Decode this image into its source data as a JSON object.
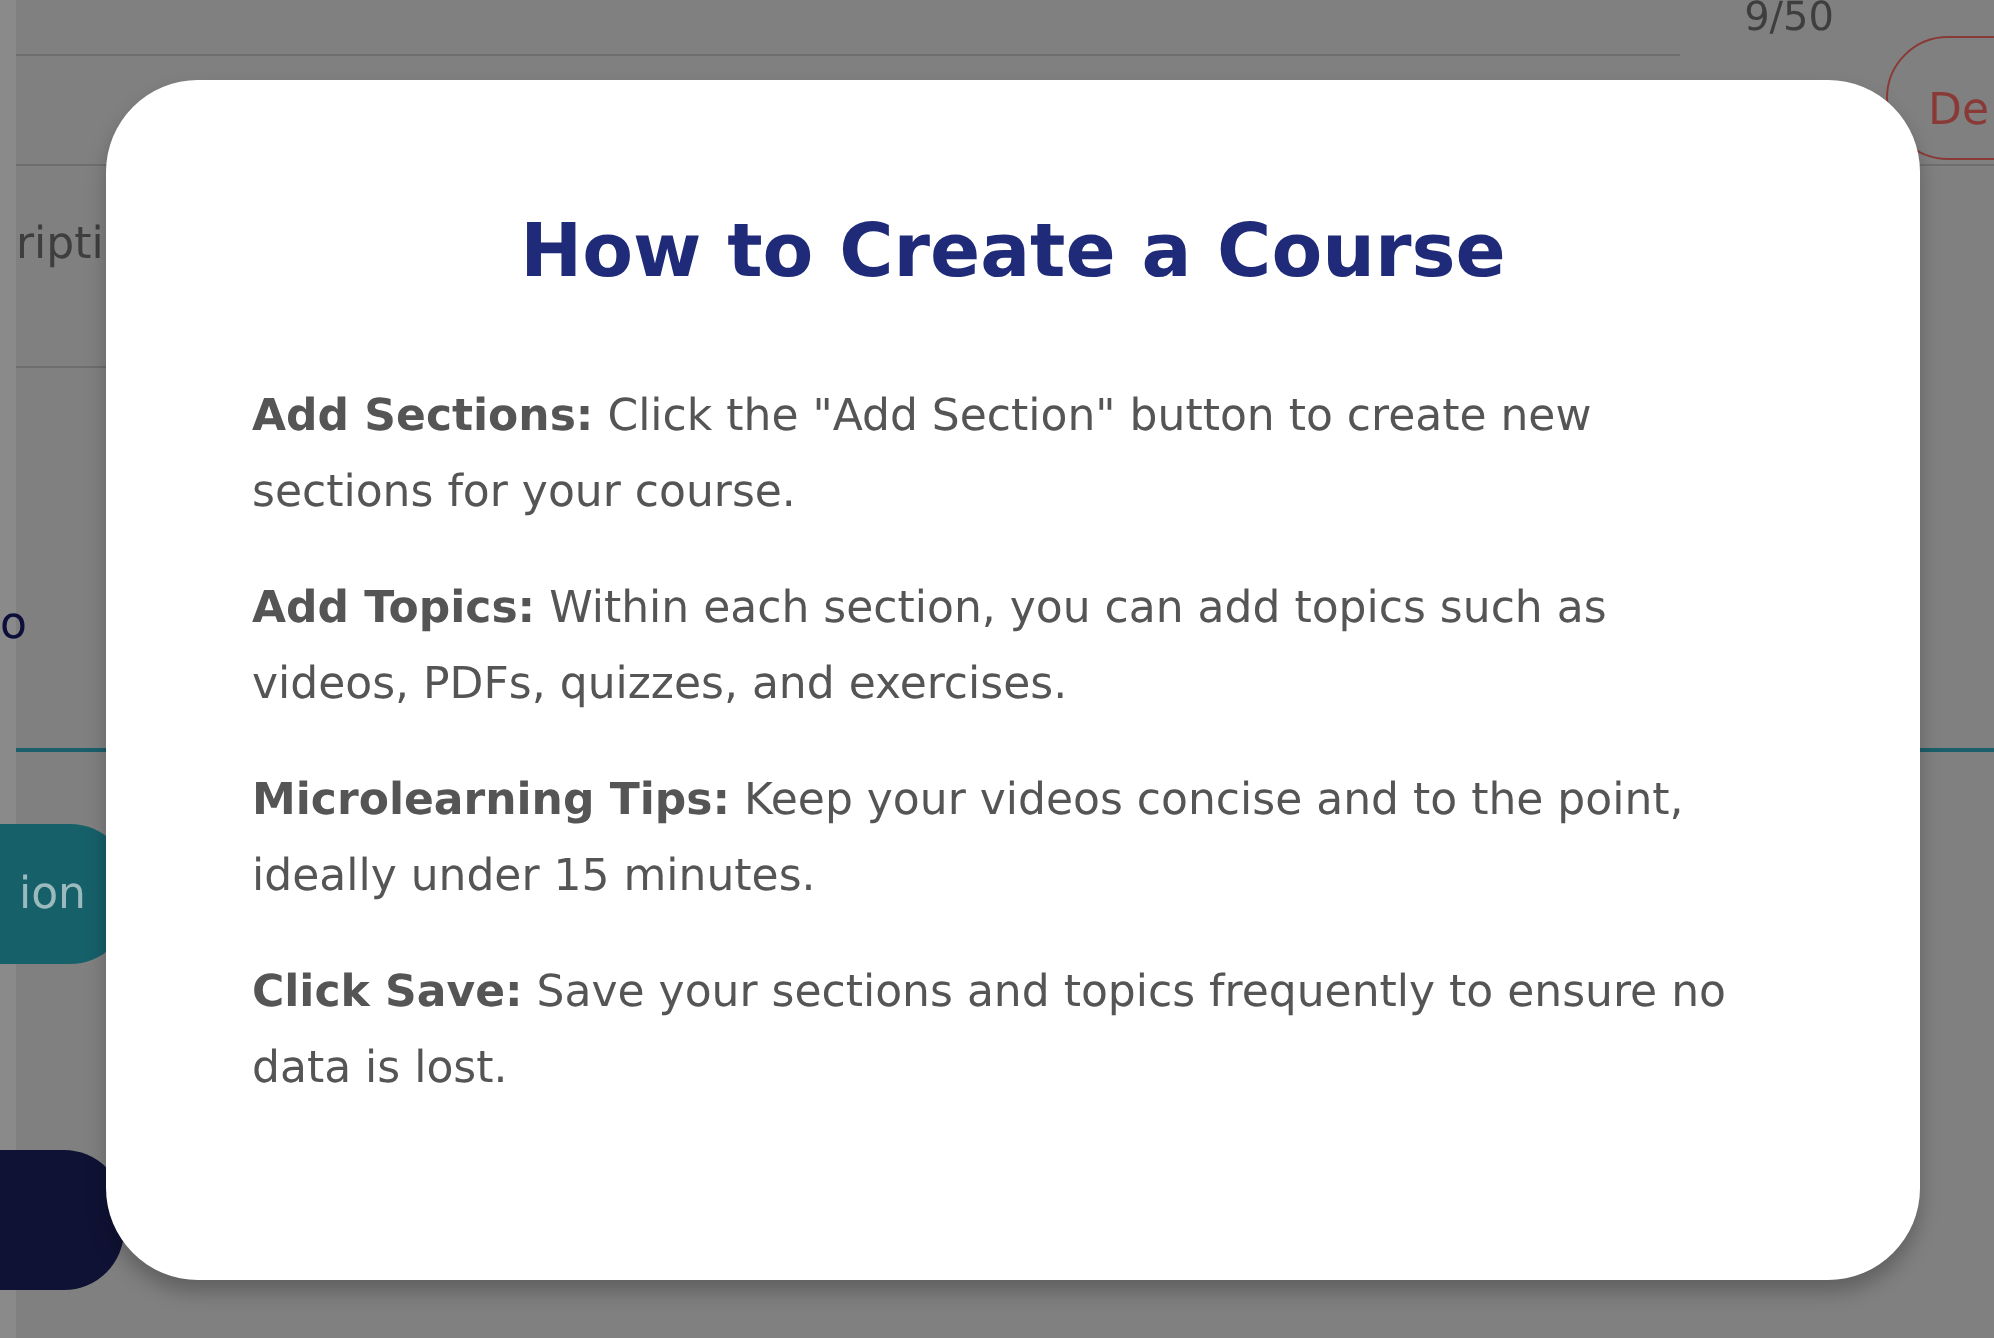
{
  "background": {
    "counter": "9/50",
    "delete_button": "De",
    "field_label": "ripti",
    "field_value": "o",
    "teal_button": "ion"
  },
  "modal": {
    "title": "How to Create a Course",
    "steps": [
      {
        "text": "**Add Sections:** Click the \"Add Section\" button to create new sections for your course."
      },
      {
        "text": "**Add Topics:** Within each section, you can add topics such as videos, PDFs, quizzes, and exercises."
      },
      {
        "text": "**Microlearning Tips:** Keep your videos concise and to the point, ideally under 15 minutes."
      },
      {
        "text": "**Click Save:** Save your sections and topics frequently to ensure no data is lost."
      }
    ]
  }
}
